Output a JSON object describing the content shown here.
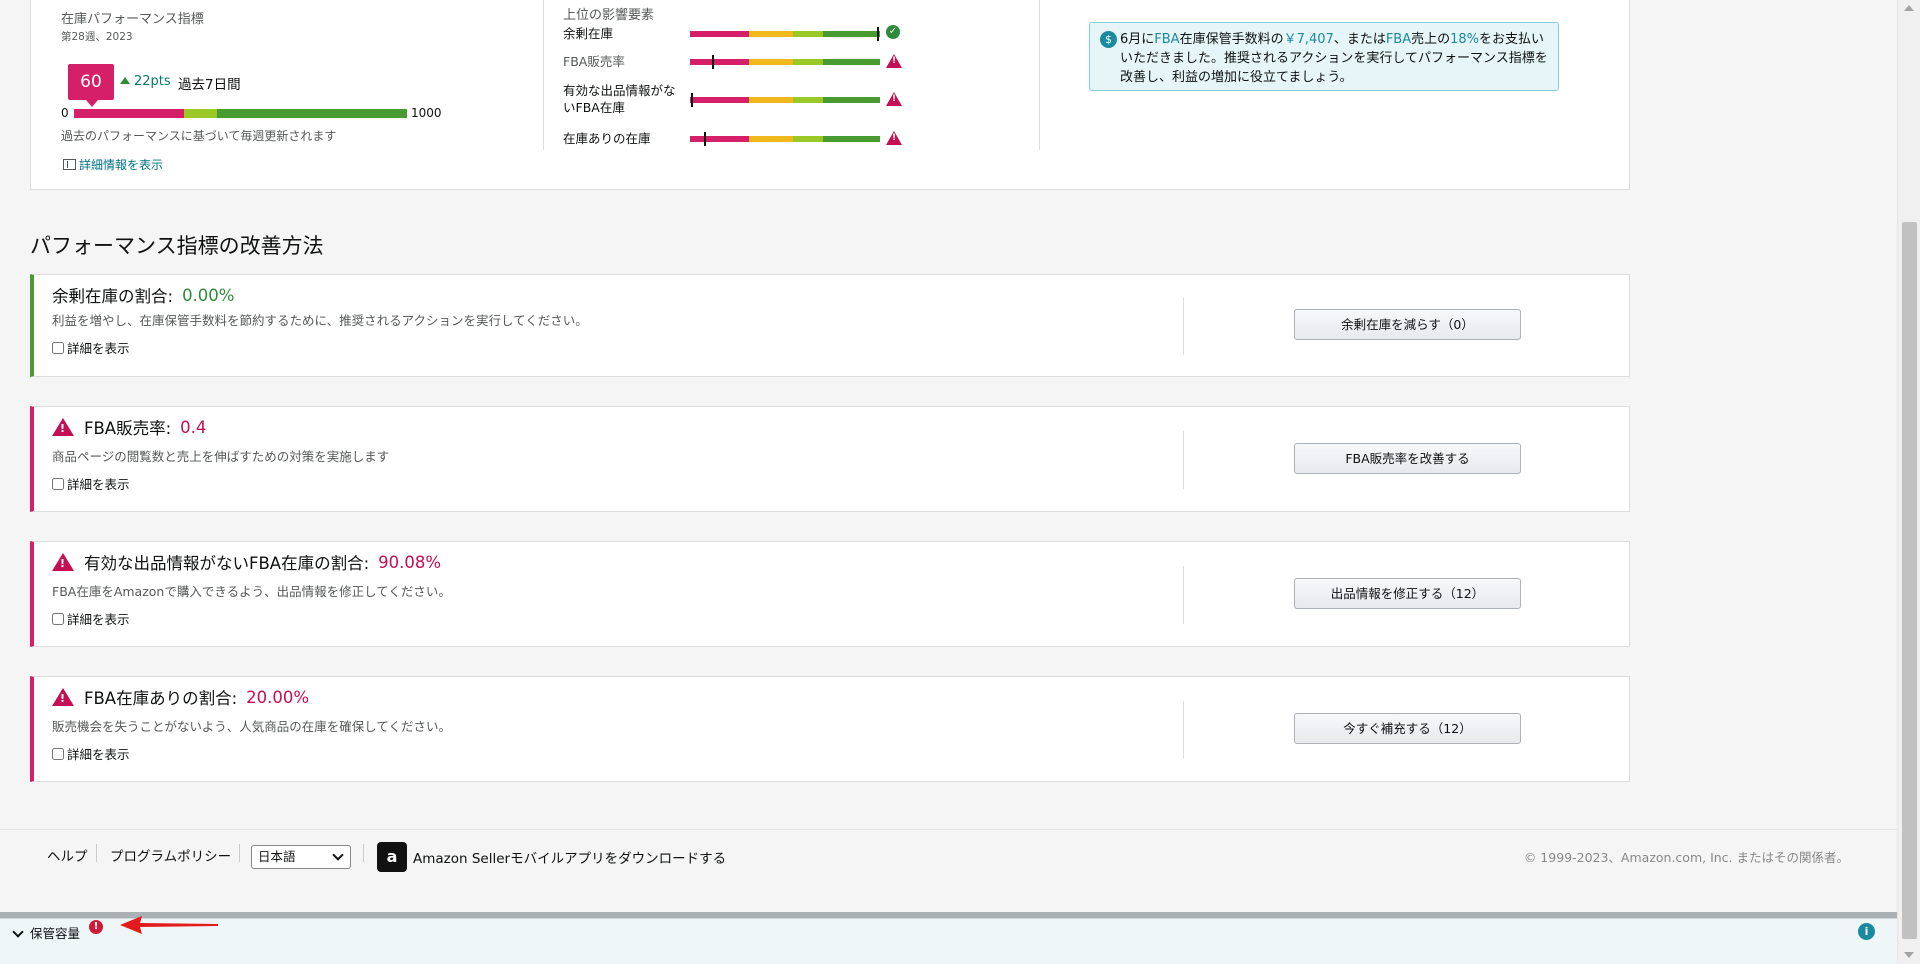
{
  "performance": {
    "title": "在庫パフォーマンス指標",
    "week": "第28週、2023",
    "score": "60",
    "score_value": 60,
    "score_max_value": 1000,
    "trend_points": "22pts",
    "trend_period": "過去7日間",
    "scale_min": "0",
    "scale_max": "1000",
    "note": "過去のパフォーマンスに基づいて毎週更新されます",
    "details_link": "詳細情報を表示",
    "bar_colors": [
      "#d61f69",
      "#9ac925",
      "#4a9a32"
    ]
  },
  "factors": {
    "title": "上位の影響要素",
    "items": [
      {
        "label": "余剰在庫",
        "status": "ok",
        "status_icon": "check-circle-icon",
        "marker_fraction": 0.99
      },
      {
        "label": "FBA販売率",
        "status": "warning",
        "status_icon": "warning-triangle-icon",
        "marker_fraction": 0.12
      },
      {
        "label": "有効な出品情報がないFBA在庫",
        "status": "warning",
        "status_icon": "warning-triangle-icon",
        "marker_fraction": 0.01
      },
      {
        "label": "在庫ありの在庫",
        "status": "warning",
        "status_icon": "warning-triangle-icon",
        "marker_fraction": 0.08
      }
    ],
    "bar_colors": [
      "#d61f69",
      "#f0b81c",
      "#9ac925",
      "#4a9a32"
    ]
  },
  "info_box": {
    "icon": "dollar-icon",
    "text_part1": "6月に",
    "text_hl1": "FBA",
    "text_part2": "在庫保管手数料の",
    "text_hl2": "￥7,407",
    "text_part3": "、または",
    "text_hl3": "FBA",
    "text_part4": "売上の",
    "text_hl4": "18%",
    "text_part5": "をお支払いいただきました。推奨されるアクションを実行してパフォーマンス指標を改善し、利益の増加に役立てましょう。"
  },
  "section_title": "パフォーマンス指標の改善方法",
  "improvements": [
    {
      "title": "余剰在庫の割合:",
      "value": "0.00%",
      "status": "good",
      "description": "利益を増やし、在庫保管手数料を節約するために、推奨されるアクションを実行してください。",
      "checkbox_label": "詳細を表示",
      "button_label": "余剰在庫を減らす（0）"
    },
    {
      "title": "FBA販売率:",
      "value": "0.4",
      "status": "bad",
      "description": "商品ページの閲覧数と売上を伸ばすための対策を実施します",
      "checkbox_label": "詳細を表示",
      "button_label": "FBA販売率を改善する"
    },
    {
      "title": "有効な出品情報がないFBA在庫の割合:",
      "value": "90.08%",
      "status": "bad",
      "description": "FBA在庫をAmazonで購入できるよう、出品情報を修正してください。",
      "checkbox_label": "詳細を表示",
      "button_label": "出品情報を修正する（12）"
    },
    {
      "title": "FBA在庫ありの割合:",
      "value": "20.00%",
      "status": "bad",
      "description": "販売機会を失うことがないよう、人気商品の在庫を確保してください。",
      "checkbox_label": "詳細を表示",
      "button_label": "今すぐ補充する（12）"
    }
  ],
  "footer": {
    "help": "ヘルプ",
    "policy": "プログラムポリシー",
    "language": "日本語",
    "app_download": "Amazon Sellerモバイルアプリをダウンロードする",
    "copyright": "© 1999-2023、Amazon.com, Inc. またはその関係者。"
  },
  "bottom_bar": {
    "label": "保管容量",
    "alert": "!",
    "info": "i"
  },
  "colors": {
    "accent_red": "#d61f69",
    "accent_green": "#2e8b3a",
    "link": "#007185",
    "info_teal": "#1c8a9e"
  }
}
